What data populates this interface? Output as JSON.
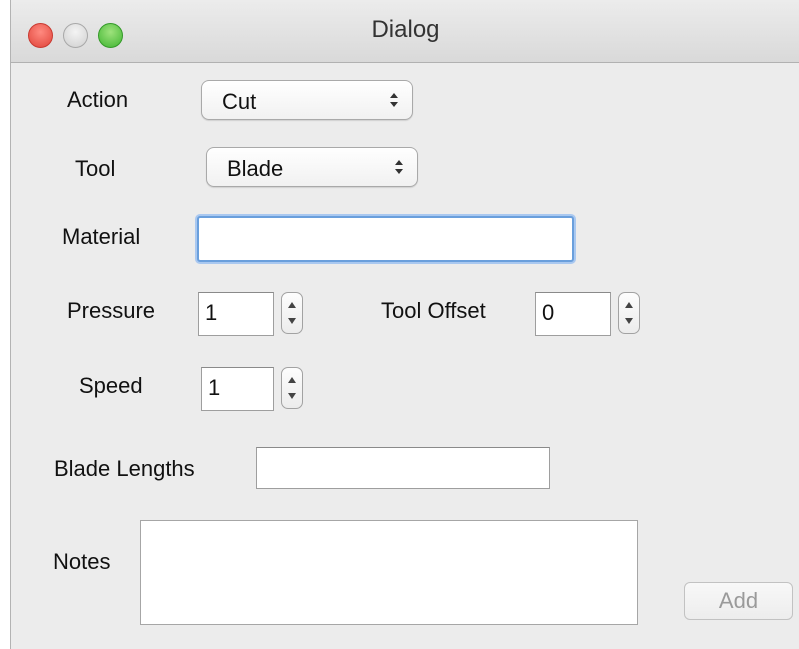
{
  "window": {
    "title": "Dialog"
  },
  "form": {
    "action_label": "Action",
    "action_value": "Cut",
    "tool_label": "Tool",
    "tool_value": "Blade",
    "material_label": "Material",
    "material_value": "",
    "pressure_label": "Pressure",
    "pressure_value": "1",
    "tool_offset_label": "Tool Offset",
    "tool_offset_value": "0",
    "speed_label": "Speed",
    "speed_value": "1",
    "blade_lengths_label": "Blade Lengths",
    "blade_lengths_value": "",
    "notes_label": "Notes",
    "notes_value": "",
    "add_label": "Add"
  },
  "colors": {
    "focus_ring": "#6a9fdc",
    "close": "#e0443a",
    "minimize": "#cfcfcf",
    "maximize": "#40b532"
  },
  "icons": [
    "close-button",
    "minimize-button",
    "maximize-button",
    "updown-arrows-icon",
    "stepper-arrows-icon"
  ]
}
